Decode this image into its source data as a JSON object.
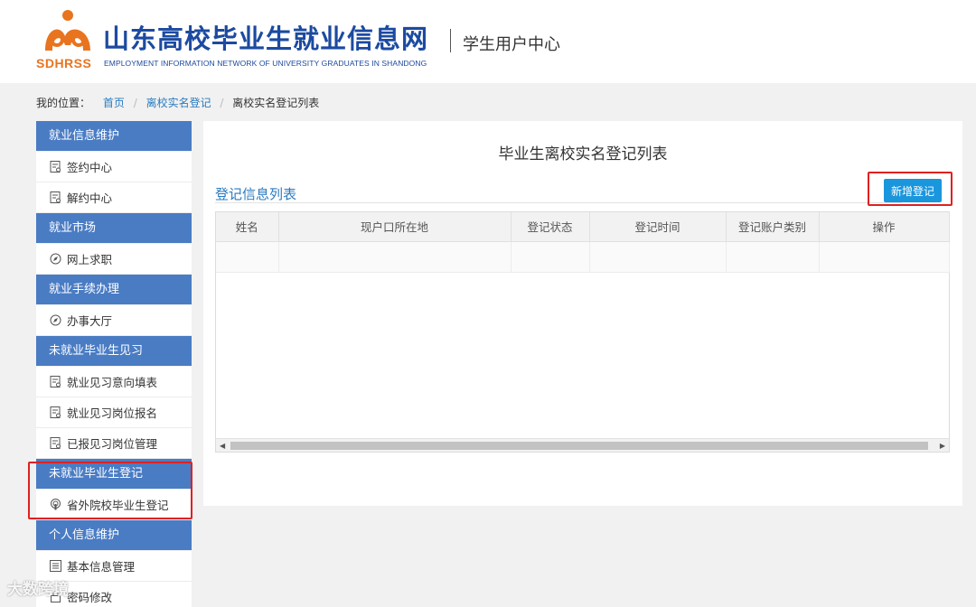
{
  "header": {
    "logo_text": "SDHRSS",
    "site_title": "山东高校毕业生就业信息网",
    "site_subtitle": "EMPLOYMENT INFORMATION NETWORK OF UNIVERSITY GRADUATES IN SHANDONG",
    "user_center": "学生用户中心"
  },
  "breadcrumb": {
    "label": "我的位置：",
    "items": [
      "首页",
      "离校实名登记",
      "离校实名登记列表"
    ]
  },
  "sidebar": [
    {
      "title": "就业信息维护",
      "items": [
        {
          "label": "签约中心",
          "icon": "document-icon"
        },
        {
          "label": "解约中心",
          "icon": "document-icon"
        }
      ]
    },
    {
      "title": "就业市场",
      "items": [
        {
          "label": "网上求职",
          "icon": "compass-icon"
        }
      ]
    },
    {
      "title": "就业手续办理",
      "items": [
        {
          "label": "办事大厅",
          "icon": "compass-icon"
        }
      ]
    },
    {
      "title": "未就业毕业生见习",
      "items": [
        {
          "label": "就业见习意向填表",
          "icon": "document-icon"
        },
        {
          "label": "就业见习岗位报名",
          "icon": "document-icon"
        },
        {
          "label": "已报见习岗位管理",
          "icon": "document-icon"
        }
      ]
    },
    {
      "title": "未就业毕业生登记",
      "items": [
        {
          "label": "省外院校毕业生登记",
          "icon": "podcast-icon"
        }
      ]
    },
    {
      "title": "个人信息维护",
      "items": [
        {
          "label": "基本信息管理",
          "icon": "list-icon"
        },
        {
          "label": "密码修改",
          "icon": "lock-icon"
        }
      ]
    }
  ],
  "main": {
    "page_title": "毕业生离校实名登记列表",
    "list_title": "登记信息列表",
    "add_button": "新增登记",
    "table": {
      "columns": [
        "姓名",
        "现户口所在地",
        "登记状态",
        "登记时间",
        "登记账户类别",
        "操作"
      ]
    }
  },
  "watermark": "大数跨境",
  "colors": {
    "accent": "#4a7cc4",
    "link": "#2a7bc0",
    "button": "#1a96dd",
    "highlight": "#e02020",
    "logo_orange": "#e8741f"
  }
}
